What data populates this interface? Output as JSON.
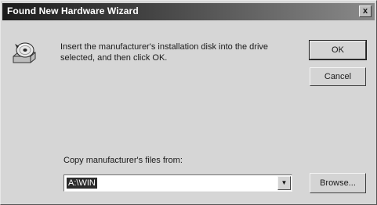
{
  "window": {
    "title": "Found New Hardware Wizard",
    "close_glyph": "x"
  },
  "message": {
    "icon": "disk-icon",
    "text": "Insert the manufacturer's installation disk into the drive selected, and then click OK."
  },
  "buttons": {
    "ok_label": "OK",
    "cancel_label": "Cancel",
    "browse_label": "Browse..."
  },
  "copy_from": {
    "label": "Copy manufacturer's files from:",
    "value": "A:\\WIN"
  },
  "colors": {
    "dialog_bg": "#d6d6d6",
    "titlebar_start": "#1c1c1c",
    "titlebar_end": "#8a8a8a",
    "selection_bg": "#2c2c2c"
  }
}
